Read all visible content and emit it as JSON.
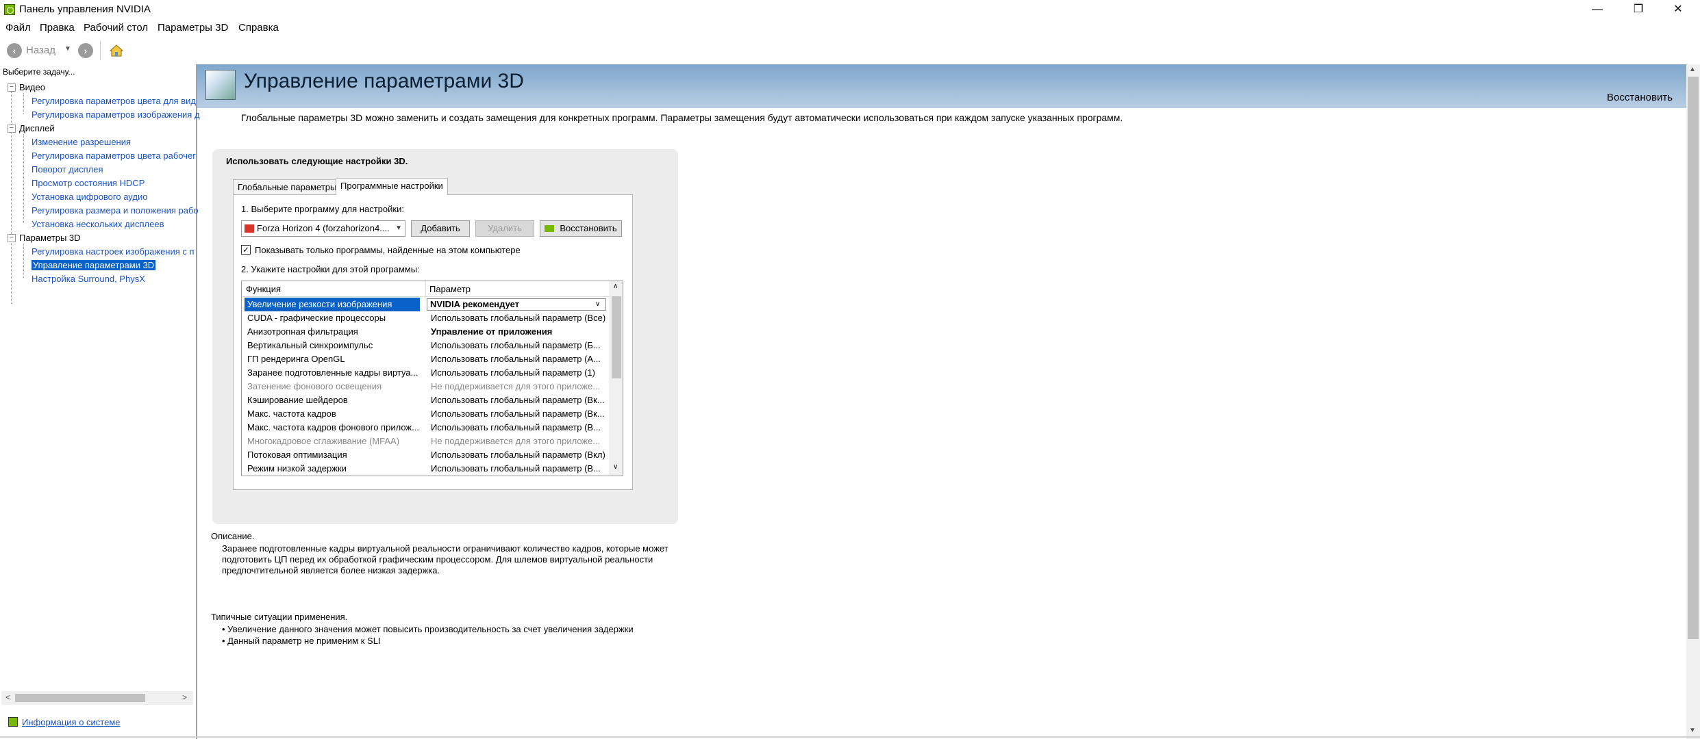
{
  "window": {
    "title": "Панель управления NVIDIA",
    "minimize": "—",
    "maximize": "❐",
    "close": "✕"
  },
  "menu": [
    "Файл",
    "Правка",
    "Рабочий стол",
    "Параметры 3D",
    "Справка"
  ],
  "toolbar": {
    "back_label": "Назад",
    "back_glyph": "‹",
    "forward_glyph": "›"
  },
  "sidebar": {
    "header": "Выберите задачу...",
    "categories": [
      {
        "label": "Видео",
        "items": [
          "Регулировка параметров цвета для вид",
          "Регулировка параметров изображения д"
        ]
      },
      {
        "label": "Дисплей",
        "items": [
          "Изменение разрешения",
          "Регулировка параметров цвета рабочег",
          "Поворот дисплея",
          "Просмотр состояния HDCP",
          "Установка цифрового аудио",
          "Регулировка размера и положения рабо",
          "Установка нескольких дисплеев"
        ]
      },
      {
        "label": "Параметры 3D",
        "items": [
          "Регулировка настроек изображения с п",
          "Управление параметрами 3D",
          "Настройка Surround, PhysX"
        ]
      }
    ],
    "system_info": "Информация о системе"
  },
  "main": {
    "title": "Управление параметрами 3D",
    "restore": "Восстановить",
    "description": "Глобальные параметры 3D можно заменить и создать замещения для конкретных программ. Параметры замещения будут автоматически использоваться при каждом запуске указанных программ.",
    "use_settings_label": "Использовать следующие настройки 3D.",
    "tabs": [
      "Глобальные параметры",
      "Программные настройки"
    ],
    "step1": "1. Выберите программу для настройки:",
    "program_selected": "Forza Horizon 4 (forzahorizon4....",
    "btn_add": "Добавить",
    "btn_delete": "Удалить",
    "btn_restore": "Восстановить",
    "checkbox_label": "Показывать только программы, найденные на этом компьютере",
    "checkbox_checked": "✓",
    "step2": "2. Укажите настройки для этой программы:",
    "table": {
      "headers": [
        "Функция",
        "Параметр"
      ],
      "rows": [
        {
          "fn": "Увеличение резкости изображения",
          "val": "NVIDIA рекомендует"
        },
        {
          "fn": "CUDA - графические процессоры",
          "val": "Использовать глобальный параметр (Все)"
        },
        {
          "fn": "Анизотропная фильтрация",
          "val": "Управление от приложения"
        },
        {
          "fn": "Вертикальный синхроимпульс",
          "val": "Использовать глобальный параметр (Б..."
        },
        {
          "fn": "ГП рендеринга OpenGL",
          "val": "Использовать глобальный параметр (А..."
        },
        {
          "fn": "Заранее подготовленные кадры виртуа...",
          "val": "Использовать глобальный параметр (1)"
        },
        {
          "fn": "Затенение фонового освещения",
          "val": "Не поддерживается для этого приложе..."
        },
        {
          "fn": "Кэширование шейдеров",
          "val": "Использовать глобальный параметр (Вк..."
        },
        {
          "fn": "Макс. частота кадров",
          "val": "Использовать глобальный параметр (Вк..."
        },
        {
          "fn": "Макс. частота кадров фонового прилож...",
          "val": "Использовать глобальный параметр (В..."
        },
        {
          "fn": "Многокадровое сглаживание (MFAA)",
          "val": "Не поддерживается для этого приложе..."
        },
        {
          "fn": "Потоковая оптимизация",
          "val": "Использовать глобальный параметр (Вкл)"
        },
        {
          "fn": "Режим низкой задержки",
          "val": "Использовать глобальный параметр (В..."
        }
      ]
    },
    "desc_title": "Описание.",
    "desc_body": "Заранее подготовленные кадры виртуальной реальности ограничивают количество кадров, которые может подготовить ЦП перед их обработкой графическим процессором. Для шлемов виртуальной реальности предпочтительной является более низкая задержка.",
    "typical_title": "Типичные ситуации применения.",
    "typical_items": [
      "• Увеличение данного значения может повысить производительность за счет увеличения задержки",
      "• Данный параметр не применим к SLI"
    ]
  }
}
